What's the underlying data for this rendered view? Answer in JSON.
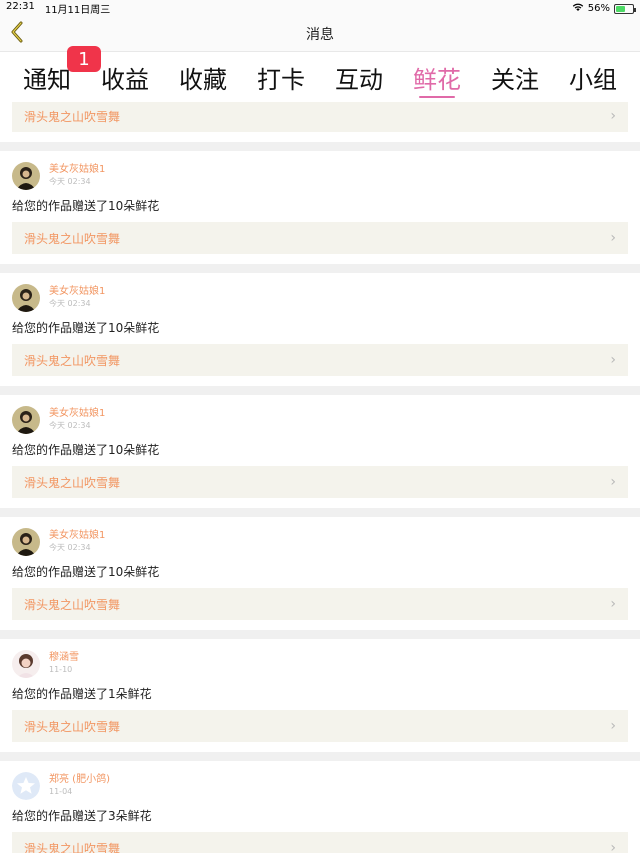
{
  "status": {
    "time": "22:31",
    "date": "11月11日周三",
    "battery": "56%",
    "battery_level": 0.56,
    "icons": [
      "wifi-icon",
      "battery-icon"
    ]
  },
  "nav": {
    "title": "消息",
    "back_icon": "chevron-left-icon"
  },
  "tabs": [
    {
      "label": "通知",
      "badge": "1"
    },
    {
      "label": "收益"
    },
    {
      "label": "收藏"
    },
    {
      "label": "打卡"
    },
    {
      "label": "互动"
    },
    {
      "label": "鲜花",
      "active": true
    },
    {
      "label": "关注"
    },
    {
      "label": "小组"
    }
  ],
  "colors": {
    "accent": "#e06aa8",
    "badge": "#f0344a",
    "name": "#f29662",
    "link_bg": "#f4f3ec"
  },
  "top_partial": {
    "work_title": "滑头鬼之山吹雪舞"
  },
  "messages": [
    {
      "user": "美女灰姑娘1",
      "time": "今天 02:34",
      "text": "给您的作品赠送了10朵鲜花",
      "work_title": "滑头鬼之山吹雪舞",
      "avatar": "dark-portrait"
    },
    {
      "user": "美女灰姑娘1",
      "time": "今天 02:34",
      "text": "给您的作品赠送了10朵鲜花",
      "work_title": "滑头鬼之山吹雪舞",
      "avatar": "dark-portrait"
    },
    {
      "user": "美女灰姑娘1",
      "time": "今天 02:34",
      "text": "给您的作品赠送了10朵鲜花",
      "work_title": "滑头鬼之山吹雪舞",
      "avatar": "dark-portrait"
    },
    {
      "user": "美女灰姑娘1",
      "time": "今天 02:34",
      "text": "给您的作品赠送了10朵鲜花",
      "work_title": "滑头鬼之山吹雪舞",
      "avatar": "dark-portrait"
    },
    {
      "user": "穆涵雪",
      "time": "11-10",
      "text": "给您的作品赠送了1朵鲜花",
      "work_title": "滑头鬼之山吹雪舞",
      "avatar": "light-portrait"
    },
    {
      "user": "郑亮 (肥小鸽)",
      "time": "11-04",
      "text": "给您的作品赠送了3朵鲜花",
      "work_title": "滑头鬼之山吹雪舞",
      "avatar": "default-star"
    }
  ]
}
